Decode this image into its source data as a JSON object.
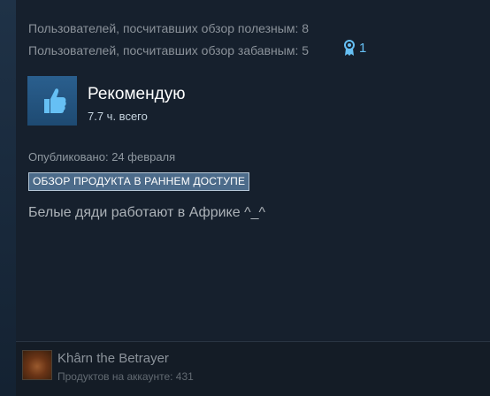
{
  "stats": {
    "helpful": "Пользователей, посчитавших обзор полезным: 8",
    "funny": "Пользователей, посчитавших обзор забавным: 5",
    "awards_count": "1"
  },
  "recommendation": {
    "title": "Рекомендую",
    "hours": "7.7 ч. всего",
    "icon": "thumbs-up-icon"
  },
  "posted": "Опубликовано: 24 февраля",
  "early_access_badge": "ОБЗОР ПРОДУКТА В РАННЕМ ДОСТУПЕ",
  "review_text": "Белые дяди работают в Африке ^_^",
  "author": {
    "name": "Khârn the Betrayer",
    "products": "Продуктов на аккаунте: 431"
  },
  "colors": {
    "accent": "#66c0f4",
    "card_bg": "#16202d",
    "badge_bg": "#4c6b8a"
  }
}
